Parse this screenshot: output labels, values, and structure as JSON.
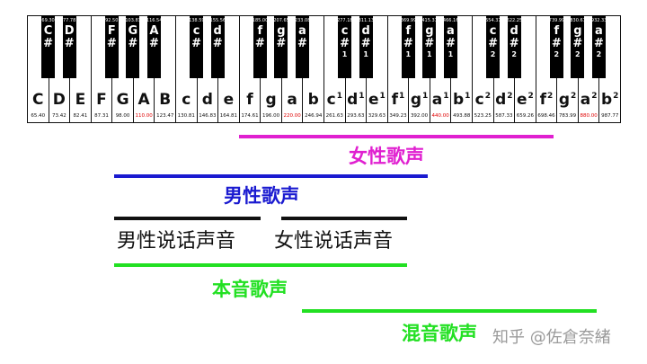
{
  "white_keys": [
    {
      "note": "C",
      "octave": "",
      "freq": "65.40",
      "highlight": false
    },
    {
      "note": "D",
      "octave": "",
      "freq": "73.42",
      "highlight": false
    },
    {
      "note": "E",
      "octave": "",
      "freq": "82.41",
      "highlight": false
    },
    {
      "note": "F",
      "octave": "",
      "freq": "87.31",
      "highlight": false
    },
    {
      "note": "G",
      "octave": "",
      "freq": "98.00",
      "highlight": false
    },
    {
      "note": "A",
      "octave": "",
      "freq": "110.00",
      "highlight": true
    },
    {
      "note": "B",
      "octave": "",
      "freq": "123.47",
      "highlight": false
    },
    {
      "note": "c",
      "octave": "",
      "freq": "130.81",
      "highlight": false
    },
    {
      "note": "d",
      "octave": "",
      "freq": "146.83",
      "highlight": false
    },
    {
      "note": "e",
      "octave": "",
      "freq": "164.81",
      "highlight": false
    },
    {
      "note": "f",
      "octave": "",
      "freq": "174.61",
      "highlight": false
    },
    {
      "note": "g",
      "octave": "",
      "freq": "196.00",
      "highlight": false
    },
    {
      "note": "a",
      "octave": "",
      "freq": "220.00",
      "highlight": true
    },
    {
      "note": "b",
      "octave": "",
      "freq": "246.94",
      "highlight": false
    },
    {
      "note": "c",
      "octave": "1",
      "freq": "261.63",
      "highlight": false
    },
    {
      "note": "d",
      "octave": "1",
      "freq": "293.63",
      "highlight": false
    },
    {
      "note": "e",
      "octave": "1",
      "freq": "329.63",
      "highlight": false
    },
    {
      "note": "f",
      "octave": "1",
      "freq": "349.23",
      "highlight": false
    },
    {
      "note": "g",
      "octave": "1",
      "freq": "392.00",
      "highlight": false
    },
    {
      "note": "a",
      "octave": "1",
      "freq": "440.00",
      "highlight": true
    },
    {
      "note": "b",
      "octave": "1",
      "freq": "493.88",
      "highlight": false
    },
    {
      "note": "c",
      "octave": "2",
      "freq": "523.25",
      "highlight": false
    },
    {
      "note": "d",
      "octave": "2",
      "freq": "587.33",
      "highlight": false
    },
    {
      "note": "e",
      "octave": "2",
      "freq": "659.26",
      "highlight": false
    },
    {
      "note": "f",
      "octave": "2",
      "freq": "698.46",
      "highlight": false
    },
    {
      "note": "g",
      "octave": "2",
      "freq": "783.99",
      "highlight": false
    },
    {
      "note": "a",
      "octave": "2",
      "freq": "880.00",
      "highlight": true
    },
    {
      "note": "b",
      "octave": "2",
      "freq": "987.77",
      "highlight": false
    }
  ],
  "black_keys": [
    {
      "note": "C",
      "sharp": "#",
      "octave": "",
      "freq": "69.30",
      "after_white": 0
    },
    {
      "note": "D",
      "sharp": "#",
      "octave": "",
      "freq": "77.78",
      "after_white": 1
    },
    {
      "note": "F",
      "sharp": "#",
      "octave": "",
      "freq": "92.50",
      "after_white": 3
    },
    {
      "note": "G",
      "sharp": "#",
      "octave": "",
      "freq": "103.83",
      "after_white": 4
    },
    {
      "note": "A",
      "sharp": "#",
      "octave": "",
      "freq": "116.54",
      "after_white": 5
    },
    {
      "note": "c",
      "sharp": "#",
      "octave": "",
      "freq": "138.59",
      "after_white": 7
    },
    {
      "note": "d",
      "sharp": "#",
      "octave": "",
      "freq": "155.56",
      "after_white": 8
    },
    {
      "note": "f",
      "sharp": "#",
      "octave": "",
      "freq": "185.00",
      "after_white": 10
    },
    {
      "note": "g",
      "sharp": "#",
      "octave": "",
      "freq": "207.65",
      "after_white": 11
    },
    {
      "note": "a",
      "sharp": "#",
      "octave": "",
      "freq": "233.08",
      "after_white": 12
    },
    {
      "note": "c",
      "sharp": "#",
      "octave": "1",
      "freq": "277.18",
      "after_white": 14
    },
    {
      "note": "d",
      "sharp": "#",
      "octave": "1",
      "freq": "311.13",
      "after_white": 15
    },
    {
      "note": "f",
      "sharp": "#",
      "octave": "1",
      "freq": "369.99",
      "after_white": 17
    },
    {
      "note": "g",
      "sharp": "#",
      "octave": "1",
      "freq": "415.31",
      "after_white": 18
    },
    {
      "note": "a",
      "sharp": "#",
      "octave": "1",
      "freq": "466.16",
      "after_white": 19
    },
    {
      "note": "c",
      "sharp": "#",
      "octave": "2",
      "freq": "554.37",
      "after_white": 21
    },
    {
      "note": "d",
      "sharp": "#",
      "octave": "2",
      "freq": "622.25",
      "after_white": 22
    },
    {
      "note": "f",
      "sharp": "#",
      "octave": "2",
      "freq": "739.99",
      "after_white": 24
    },
    {
      "note": "g",
      "sharp": "#",
      "octave": "2",
      "freq": "830.61",
      "after_white": 25
    },
    {
      "note": "a",
      "sharp": "#",
      "octave": "2",
      "freq": "932.33",
      "after_white": 26
    }
  ],
  "colors": {
    "highlight_freq": "#e00000",
    "female_singing": "#e020d0",
    "male_singing": "#1a1ad0",
    "speaking": "#111111",
    "chest_voice": "#22e022",
    "mixed_voice": "#22e022",
    "watermark": "#9a9a9a"
  },
  "ranges": {
    "female_singing": {
      "label": "女性歌声"
    },
    "male_singing": {
      "label": "男性歌声"
    },
    "male_speaking": {
      "label": "男性说话声音"
    },
    "female_speaking": {
      "label": "女性说话声音"
    },
    "chest_voice": {
      "label": "本音歌声"
    },
    "mixed_voice": {
      "label": "混音歌声"
    }
  },
  "watermark": "知乎 @佐倉奈緒"
}
